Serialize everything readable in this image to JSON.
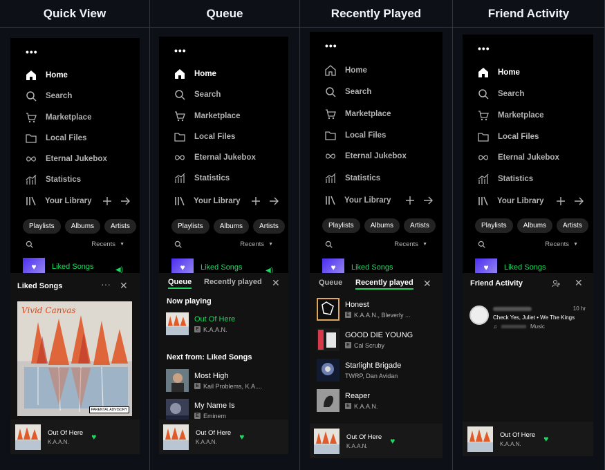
{
  "columns": [
    {
      "title": "Quick View"
    },
    {
      "title": "Queue"
    },
    {
      "title": "Recently Played"
    },
    {
      "title": "Friend Activity"
    }
  ],
  "sidebar": {
    "menu_dots": "•••",
    "nav": [
      {
        "label": "Home",
        "icon": "home-icon"
      },
      {
        "label": "Search",
        "icon": "search-icon"
      },
      {
        "label": "Marketplace",
        "icon": "cart-icon"
      },
      {
        "label": "Local Files",
        "icon": "folder-icon"
      },
      {
        "label": "Eternal Jukebox",
        "icon": "infinity-icon"
      },
      {
        "label": "Statistics",
        "icon": "stats-icon"
      }
    ],
    "library_label": "Your Library",
    "chips": [
      "Playlists",
      "Albums",
      "Artists"
    ],
    "sort_label": "Recents",
    "liked_songs": "Liked Songs"
  },
  "quick_view": {
    "title": "Liked Songs",
    "album_title": "Vivid Canvas",
    "advisory": "PARENTAL ADVISORY",
    "dots": "···"
  },
  "queue": {
    "tab_queue": "Queue",
    "tab_recent": "Recently played",
    "now_playing_label": "Now playing",
    "now_playing": {
      "name": "Out Of Here",
      "artist": "K.A.A.N."
    },
    "next_from_label": "Next from: Liked Songs",
    "next": [
      {
        "name": "Most High",
        "artist": "Kail Problems, K.A...."
      },
      {
        "name": "My Name Is",
        "artist": "Eminem"
      }
    ]
  },
  "recently_played": {
    "tab_queue": "Queue",
    "tab_recent": "Recently played",
    "tracks": [
      {
        "name": "Honest",
        "artist": "K.A.A.N., Bleverly ...",
        "explicit": true
      },
      {
        "name": "GOOD DIE YOUNG",
        "artist": "Cal Scruby",
        "explicit": true
      },
      {
        "name": "Starlight Brigade",
        "artist": "TWRP, Dan Avidan",
        "explicit": false
      },
      {
        "name": "Reaper",
        "artist": "K.A.A.N.",
        "explicit": true
      }
    ]
  },
  "friend_activity": {
    "title": "Friend Activity",
    "item": {
      "time": "10 hr",
      "track": "Check Yes, Juliet • We The Kings",
      "context": "Music"
    }
  },
  "now_playing_bar": {
    "name": "Out Of Here",
    "artist": "K.A.A.N."
  },
  "colors": {
    "accent": "#1ed760",
    "background": "#000000",
    "panel": "#121212"
  }
}
